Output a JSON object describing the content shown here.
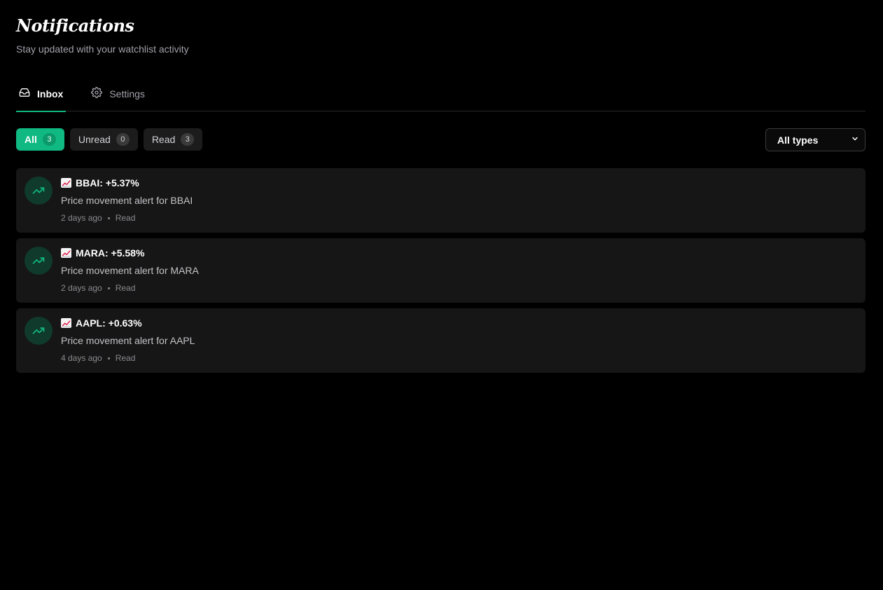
{
  "header": {
    "title": "Notifications",
    "subtitle": "Stay updated with your watchlist activity"
  },
  "tabs": [
    {
      "label": "Inbox",
      "icon": "inbox-icon",
      "active": true
    },
    {
      "label": "Settings",
      "icon": "gear-icon",
      "active": false
    }
  ],
  "filters": [
    {
      "label": "All",
      "count": "3",
      "active": true
    },
    {
      "label": "Unread",
      "count": "0",
      "active": false
    },
    {
      "label": "Read",
      "count": "3",
      "active": false
    }
  ],
  "type_filter": {
    "selected": "All types"
  },
  "colors": {
    "accent": "#10b981",
    "background": "#000000",
    "card": "#161616"
  },
  "notifications": [
    {
      "icon": "trending-up-icon",
      "title": "BBAI: +5.37%",
      "description": "Price movement alert for BBAI",
      "time": "2 days ago",
      "status": "Read"
    },
    {
      "icon": "trending-up-icon",
      "title": "MARA: +5.58%",
      "description": "Price movement alert for MARA",
      "time": "2 days ago",
      "status": "Read"
    },
    {
      "icon": "trending-up-icon",
      "title": "AAPL: +0.63%",
      "description": "Price movement alert for AAPL",
      "time": "4 days ago",
      "status": "Read"
    }
  ]
}
